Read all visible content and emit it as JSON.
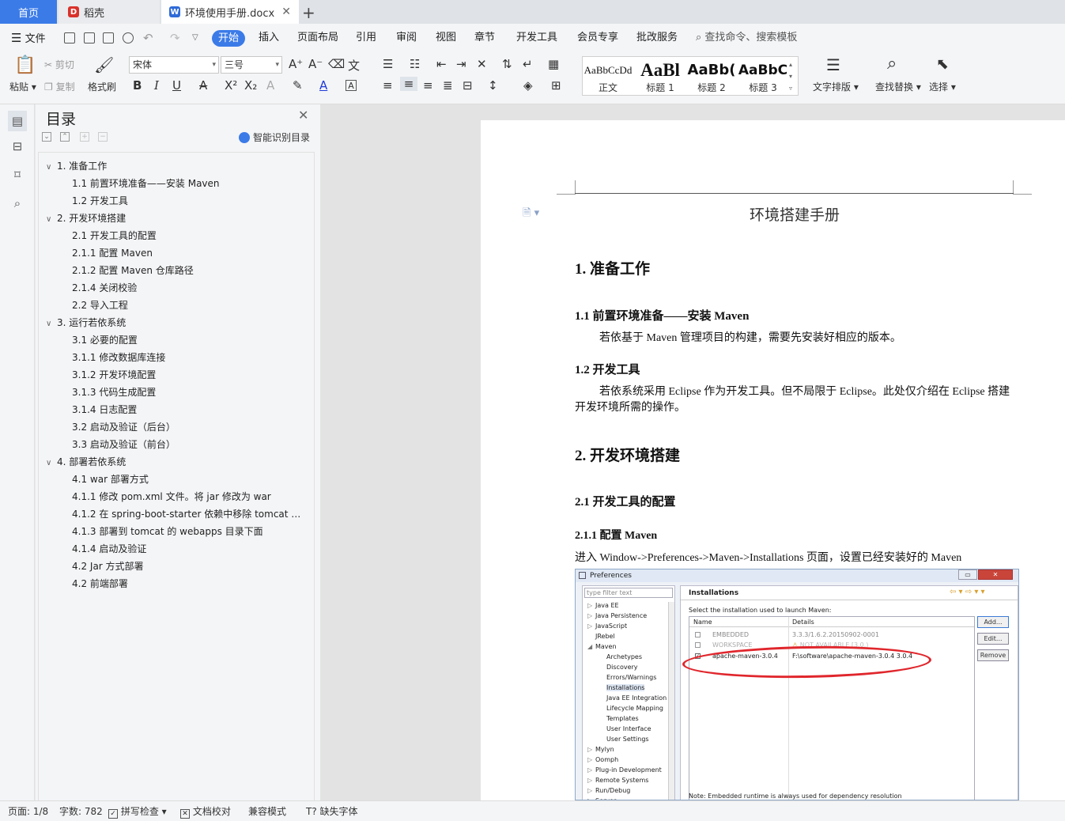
{
  "tabs": {
    "home": "首页",
    "daoke": "稻壳",
    "doc": "环境使用手册.docx"
  },
  "menu": {
    "file": "文件",
    "items": [
      "开始",
      "插入",
      "页面布局",
      "引用",
      "审阅",
      "视图",
      "章节",
      "开发工具",
      "会员专享",
      "批改服务"
    ],
    "search": "查找命令、搜索模板"
  },
  "ribbon": {
    "paste": "粘贴",
    "cut": "剪切",
    "copy": "复制",
    "format_painter": "格式刷",
    "font_name": "宋体",
    "font_size": "三号",
    "styles": [
      {
        "preview": "AaBbCcDd",
        "name": "正文"
      },
      {
        "preview": "AaBl",
        "name": "标题 1"
      },
      {
        "preview": "AaBb(",
        "name": "标题 2"
      },
      {
        "preview": "AaBbC",
        "name": "标题 3"
      }
    ],
    "text_layout": "文字排版",
    "find_replace": "查找替换",
    "select": "选择"
  },
  "toc": {
    "title": "目录",
    "smart": "智能识别目录",
    "items": [
      {
        "level": 1,
        "text": "1. 准备工作"
      },
      {
        "level": 2,
        "text": "1.1 前置环境准备——安装 Maven"
      },
      {
        "level": 2,
        "text": "1.2 开发工具"
      },
      {
        "level": 1,
        "text": "2. 开发环境搭建"
      },
      {
        "level": 2,
        "text": "2.1 开发工具的配置"
      },
      {
        "level": 2,
        "text": "2.1.1 配置 Maven"
      },
      {
        "level": 2,
        "text": "2.1.2 配置 Maven 仓库路径"
      },
      {
        "level": 2,
        "text": "2.1.4 关闭校验"
      },
      {
        "level": 2,
        "text": "2.2 导入工程"
      },
      {
        "level": 1,
        "text": "3. 运行若依系统"
      },
      {
        "level": 2,
        "text": "3.1 必要的配置"
      },
      {
        "level": 2,
        "text": "3.1.1 修改数据库连接"
      },
      {
        "level": 2,
        "text": "3.1.2 开发环境配置"
      },
      {
        "level": 2,
        "text": "3.1.3 代码生成配置"
      },
      {
        "level": 2,
        "text": "3.1.4 日志配置"
      },
      {
        "level": 2,
        "text": "3.2 启动及验证（后台）"
      },
      {
        "level": 2,
        "text": "3.3 启动及验证（前台）"
      },
      {
        "level": 1,
        "text": "4. 部署若依系统"
      },
      {
        "level": 2,
        "text": "4.1 war 部署方式"
      },
      {
        "level": 2,
        "text": "4.1.1 修改 pom.xml 文件。将 jar 修改为 war"
      },
      {
        "level": 2,
        "text": "4.1.2 在 spring-boot-starter 依赖中移除 tomcat …"
      },
      {
        "level": 2,
        "text": "4.1.3 部署到 tomcat 的 webapps 目录下面"
      },
      {
        "level": 2,
        "text": "4.1.4 启动及验证"
      },
      {
        "level": 2,
        "text": "4.2 Jar 方式部署"
      },
      {
        "level": 2,
        "text": "4.2 前端部署"
      }
    ]
  },
  "doc": {
    "header": "环境搭建手册",
    "h1_1": "1.  准备工作",
    "h2_1": "1.1  前置环境准备——安装 Maven",
    "p_1": "若依基于 Maven 管理项目的构建，需要先安装好相应的版本。",
    "h2_2": "1.2  开发工具",
    "p_2a": "若依系统采用 Eclipse 作为开发工具。但不局限于 Eclipse。此处仅介绍在 Eclipse 搭建",
    "p_2b": "开发环境所需的操作。",
    "h1_2": "2.  开发环境搭建",
    "h2_3": "2.1  开发工具的配置",
    "h3_1": "2.1.1  配置 Maven",
    "p_3": "进入 Window->Preferences->Maven->Installations 页面，设置已经安装好的 Maven"
  },
  "eclipse": {
    "title": "Preferences",
    "filter": "type filter text",
    "tree": [
      "Java EE",
      "Java Persistence",
      "JavaScript",
      "JRebel",
      "Maven",
      "Archetypes",
      "Discovery",
      "Errors/Warnings",
      "Installations",
      "Java EE Integration",
      "Lifecycle Mapping",
      "Templates",
      "User Interface",
      "User Settings",
      "Mylyn",
      "Oomph",
      "Plug-in Development",
      "Remote Systems",
      "Run/Debug",
      "Server"
    ],
    "section": "Installations",
    "instruction": "Select the installation used to launch Maven:",
    "col_name": "Name",
    "col_details": "Details",
    "rows": [
      {
        "name": "EMBEDDED",
        "details": "3.3.3/1.6.2.20150902-0001"
      },
      {
        "name": "WORKSPACE",
        "details": "NOT AVAILABLE [3.0,)"
      },
      {
        "name": "apache-maven-3.0.4",
        "details": "F:\\software\\apache-maven-3.0.4 3.0.4"
      }
    ],
    "buttons": [
      "Add...",
      "Edit...",
      "Remove"
    ],
    "note": "Note: Embedded runtime is always used for dependency resolution"
  },
  "status": {
    "page": "页面: 1/8",
    "words": "字数: 782",
    "spell": "拼写检查",
    "proof": "文档校对",
    "compat": "兼容模式",
    "missing_font": "缺失字体"
  },
  "colors": {
    "accent": "#3b7be8",
    "annotation_red": "#e0262c"
  }
}
